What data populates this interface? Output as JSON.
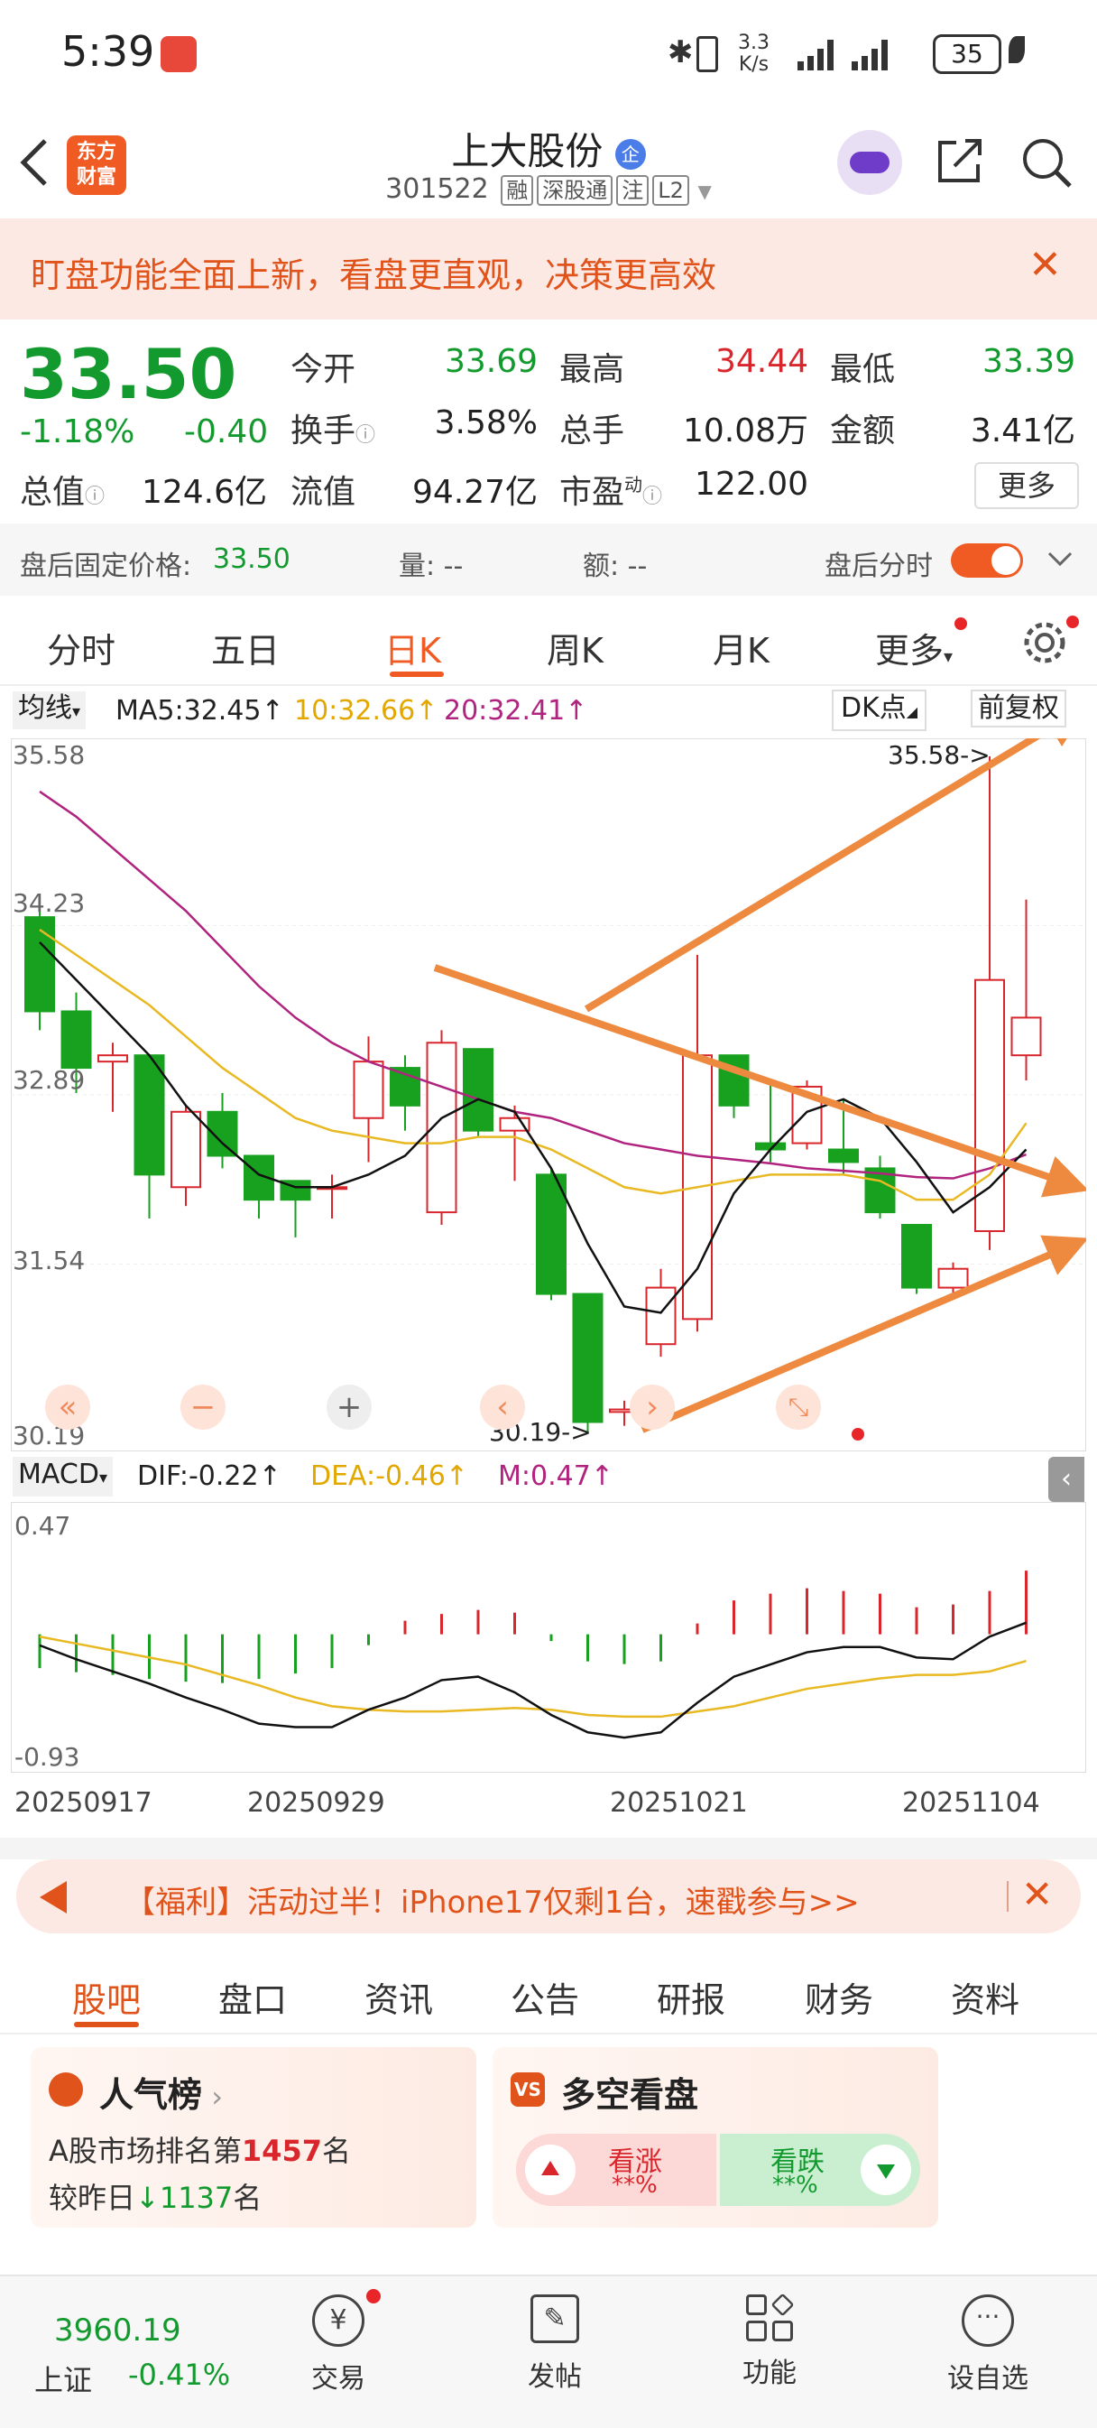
{
  "status_bar": {
    "time": "5:39",
    "net_speed_top": "3.3",
    "net_speed_unit": "K/s",
    "battery": "35"
  },
  "header": {
    "title": "上大股份",
    "enterprise_badge": "企",
    "code": "301522",
    "tags": [
      "融",
      "深股通",
      "注",
      "L2"
    ],
    "app_logo": "东方财富"
  },
  "banner": {
    "text": "盯盘功能全面上新，看盘更直观，决策更高效"
  },
  "quote": {
    "price": "33.50",
    "change_pct": "-1.18%",
    "change": "-0.40",
    "open_label": "今开",
    "open": "33.69",
    "high_label": "最高",
    "high": "34.44",
    "low_label": "最低",
    "low": "33.39",
    "turnover_label": "换手",
    "turnover": "3.58%",
    "volume_label": "总手",
    "volume": "10.08万",
    "amount_label": "金额",
    "amount": "3.41亿",
    "mktcap_label": "总值",
    "mktcap": "124.6亿",
    "float_label": "流值",
    "float": "94.27亿",
    "pe_label": "市盈",
    "pe_sup": "动",
    "pe": "122.00",
    "more_label": "更多"
  },
  "after_hours": {
    "price_label": "盘后固定价格:",
    "price": "33.50",
    "vol_label": "量: --",
    "amt_label": "额: --",
    "toggle_label": "盘后分时"
  },
  "chart_tabs": [
    "分时",
    "五日",
    "日K",
    "周K",
    "月K",
    "更多"
  ],
  "ma_bar": {
    "selector": "均线",
    "ma5": "MA5:32.45",
    "ma10": "10:32.66",
    "ma20": "20:32.41",
    "dk": "DK点",
    "adjust": "前复权"
  },
  "kline_axis": {
    "top": "35.58",
    "y2": "34.23",
    "y3": "32.89",
    "y4": "31.54",
    "bottom": "30.19",
    "max_marker": "35.58->",
    "min_marker": "30.19->"
  },
  "macd_bar": {
    "selector": "MACD",
    "dif": "DIF:-0.22",
    "dea": "DEA:-0.46",
    "m": "M:0.47",
    "top": "0.47",
    "bottom": "-0.93"
  },
  "dates": [
    "20250917",
    "20250929",
    "20251021",
    "20251104"
  ],
  "colors": {
    "up": "#d9262c",
    "down": "#18a11f",
    "ma5": "#111111",
    "ma10": "#e8b923",
    "ma20": "#b0237f",
    "accent": "#f06a1e",
    "arrow": "#ee8a3f"
  },
  "chart_data": {
    "type": "candlestick",
    "y_range": [
      30.19,
      35.58
    ],
    "candles": [
      {
        "o": 34.3,
        "h": 34.4,
        "l": 33.4,
        "c": 33.55
      },
      {
        "o": 33.55,
        "h": 33.7,
        "l": 32.9,
        "c": 33.1
      },
      {
        "o": 33.15,
        "h": 33.3,
        "l": 32.75,
        "c": 33.2
      },
      {
        "o": 33.2,
        "h": 33.2,
        "l": 31.9,
        "c": 32.25
      },
      {
        "o": 32.15,
        "h": 32.8,
        "l": 32.0,
        "c": 32.75
      },
      {
        "o": 32.75,
        "h": 32.9,
        "l": 32.3,
        "c": 32.4
      },
      {
        "o": 32.4,
        "h": 32.4,
        "l": 31.9,
        "c": 32.05
      },
      {
        "o": 32.2,
        "h": 32.2,
        "l": 31.75,
        "c": 32.05
      },
      {
        "o": 32.15,
        "h": 32.25,
        "l": 31.9,
        "c": 32.15
      },
      {
        "o": 32.7,
        "h": 33.35,
        "l": 32.35,
        "c": 33.15
      },
      {
        "o": 33.1,
        "h": 33.2,
        "l": 32.6,
        "c": 32.8
      },
      {
        "o": 31.95,
        "h": 33.4,
        "l": 31.85,
        "c": 33.3
      },
      {
        "o": 33.25,
        "h": 33.25,
        "l": 32.55,
        "c": 32.6
      },
      {
        "o": 32.6,
        "h": 32.8,
        "l": 32.2,
        "c": 32.7
      },
      {
        "o": 32.25,
        "h": 32.3,
        "l": 31.25,
        "c": 31.3
      },
      {
        "o": 31.3,
        "h": 31.3,
        "l": 30.19,
        "c": 30.28
      },
      {
        "o": 30.36,
        "h": 30.45,
        "l": 30.25,
        "c": 30.38
      },
      {
        "o": 30.9,
        "h": 31.5,
        "l": 30.8,
        "c": 31.35
      },
      {
        "o": 31.1,
        "h": 34.0,
        "l": 31.0,
        "c": 33.2
      },
      {
        "o": 33.2,
        "h": 33.2,
        "l": 32.7,
        "c": 32.8
      },
      {
        "o": 32.5,
        "h": 33.0,
        "l": 32.35,
        "c": 32.45
      },
      {
        "o": 32.5,
        "h": 33.0,
        "l": 32.45,
        "c": 32.95
      },
      {
        "o": 32.45,
        "h": 32.85,
        "l": 32.25,
        "c": 32.35
      },
      {
        "o": 32.3,
        "h": 32.4,
        "l": 31.9,
        "c": 31.95
      },
      {
        "o": 31.85,
        "h": 31.85,
        "l": 31.3,
        "c": 31.35
      },
      {
        "o": 31.35,
        "h": 31.55,
        "l": 31.3,
        "c": 31.5
      },
      {
        "o": 31.8,
        "h": 35.58,
        "l": 31.65,
        "c": 33.8
      },
      {
        "o": 33.2,
        "h": 34.44,
        "l": 33.0,
        "c": 33.5
      }
    ],
    "ma5": [
      34.1,
      33.8,
      33.5,
      33.2,
      32.8,
      32.5,
      32.25,
      32.15,
      32.15,
      32.25,
      32.4,
      32.7,
      32.85,
      32.75,
      32.3,
      31.7,
      31.2,
      31.15,
      31.5,
      32.1,
      32.45,
      32.75,
      32.85,
      32.7,
      32.35,
      31.95,
      32.15,
      32.45
    ],
    "ma10": [
      34.2,
      34.0,
      33.8,
      33.6,
      33.35,
      33.1,
      32.9,
      32.7,
      32.6,
      32.55,
      32.5,
      32.5,
      32.55,
      32.55,
      32.45,
      32.3,
      32.15,
      32.1,
      32.15,
      32.2,
      32.25,
      32.25,
      32.25,
      32.2,
      32.05,
      32.05,
      32.25,
      32.66
    ],
    "ma20": [
      35.3,
      35.1,
      34.85,
      34.6,
      34.35,
      34.05,
      33.75,
      33.5,
      33.3,
      33.15,
      33.05,
      32.95,
      32.85,
      32.75,
      32.7,
      32.6,
      32.5,
      32.45,
      32.4,
      32.37,
      32.34,
      32.3,
      32.28,
      32.26,
      32.23,
      32.22,
      32.3,
      32.41
    ],
    "macd": {
      "y_range": [
        -0.93,
        0.47
      ],
      "hist": [
        -0.25,
        -0.28,
        -0.3,
        -0.33,
        -0.35,
        -0.36,
        -0.33,
        -0.29,
        -0.25,
        -0.08,
        0.1,
        0.15,
        0.18,
        0.16,
        -0.05,
        -0.2,
        -0.22,
        -0.2,
        0.08,
        0.25,
        0.3,
        0.34,
        0.32,
        0.3,
        0.2,
        0.22,
        0.32,
        0.47
      ],
      "dif": [
        -0.25,
        -0.33,
        -0.4,
        -0.47,
        -0.55,
        -0.62,
        -0.7,
        -0.72,
        -0.72,
        -0.62,
        -0.55,
        -0.45,
        -0.43,
        -0.52,
        -0.65,
        -0.75,
        -0.78,
        -0.75,
        -0.58,
        -0.43,
        -0.36,
        -0.29,
        -0.26,
        -0.26,
        -0.32,
        -0.33,
        -0.2,
        -0.12
      ],
      "dea": [
        -0.2,
        -0.24,
        -0.28,
        -0.32,
        -0.36,
        -0.42,
        -0.48,
        -0.55,
        -0.6,
        -0.62,
        -0.63,
        -0.63,
        -0.62,
        -0.61,
        -0.62,
        -0.65,
        -0.66,
        -0.66,
        -0.63,
        -0.6,
        -0.55,
        -0.5,
        -0.47,
        -0.44,
        -0.42,
        -0.42,
        -0.4,
        -0.34
      ]
    }
  },
  "promo": {
    "text": "【福利】活动过半！iPhone17仅剩1台，速戳参与>>"
  },
  "bottom_tabs": [
    "股吧",
    "盘口",
    "资讯",
    "公告",
    "研报",
    "财务",
    "资料"
  ],
  "cards": {
    "popular": {
      "title": "人气榜",
      "line1_prefix": "A股市场排名第",
      "rank": "1457",
      "line1_suffix": "名",
      "line2_prefix": "较昨日",
      "change": "1137",
      "line2_suffix": "名"
    },
    "sentiment": {
      "title": "多空看盘",
      "bull_label": "看涨",
      "bull_value": "**%",
      "bear_label": "看跌",
      "bear_value": "**%"
    }
  },
  "bottom_nav": {
    "index_value": "3960.19",
    "index_name": "上证",
    "index_change": "-0.41%",
    "items": [
      "交易",
      "发帖",
      "功能",
      "设自选"
    ]
  }
}
